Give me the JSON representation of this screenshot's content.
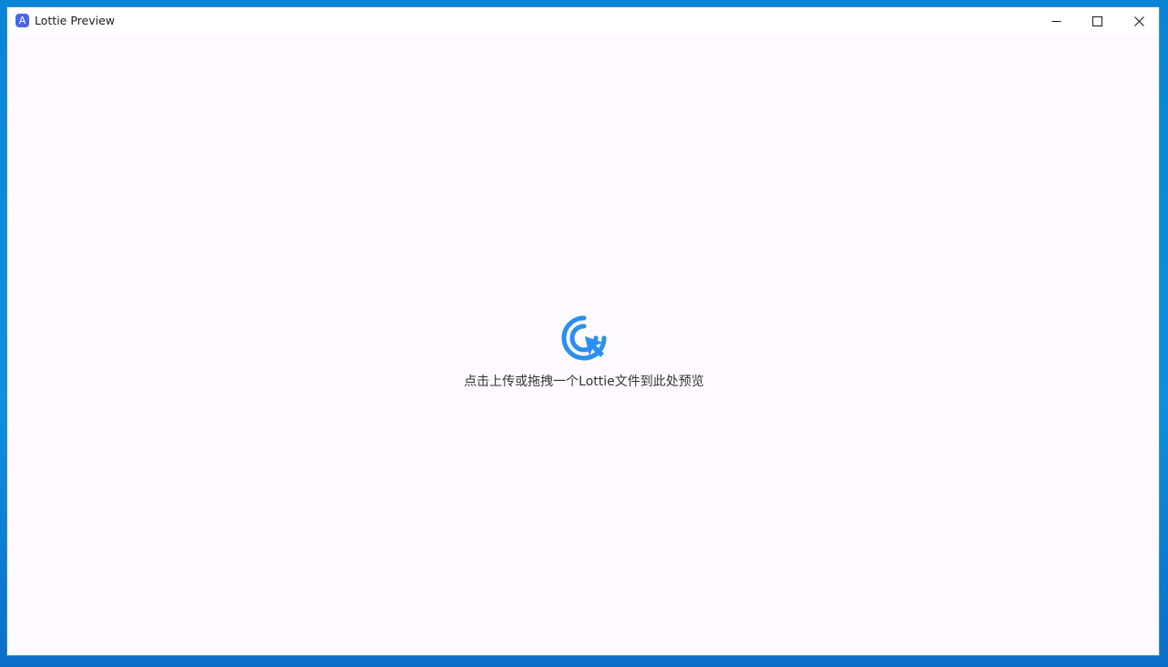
{
  "window": {
    "title": "Lottie Preview",
    "app_icon_letter": "A",
    "app_icon_color": "#4b63f2"
  },
  "controls": {
    "minimize_icon": "minimize-icon",
    "maximize_icon": "maximize-icon",
    "close_icon": "close-icon"
  },
  "upload": {
    "icon": "click-cursor-icon",
    "icon_color": "#2a8ff0",
    "prompt": "点击上传或拖拽一个Lottie文件到此处预览"
  },
  "colors": {
    "content_background": "#fefaff",
    "desktop_blue": "#0a84d6"
  }
}
